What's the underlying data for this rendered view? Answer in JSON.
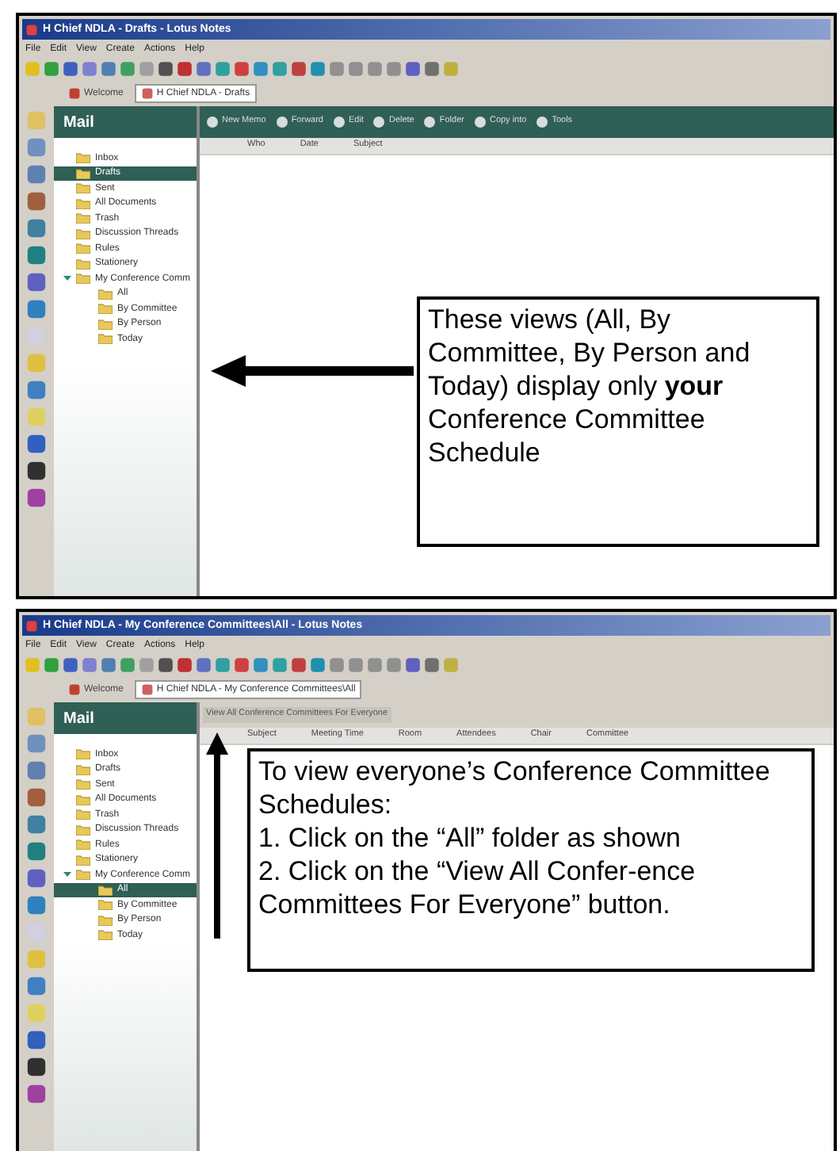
{
  "panels": [
    {
      "window_title": "H Chief NDLA - Drafts - Lotus Notes",
      "menu": [
        "File",
        "Edit",
        "View",
        "Create",
        "Actions",
        "Help"
      ],
      "tabs": [
        {
          "label": "Welcome",
          "selected": false
        },
        {
          "label": "H Chief NDLA - Drafts",
          "selected": true
        }
      ],
      "nav_title": "Mail",
      "nav_items": [
        {
          "label": "Inbox",
          "selected": false
        },
        {
          "label": "Drafts",
          "selected": true
        },
        {
          "label": "Sent",
          "selected": false
        },
        {
          "label": "All Documents",
          "selected": false
        },
        {
          "label": "Trash",
          "selected": false
        },
        {
          "label": "Discussion Threads",
          "selected": false
        },
        {
          "label": "Rules",
          "selected": false
        },
        {
          "label": "Stationery",
          "selected": false
        },
        {
          "label": "My Conference Comm",
          "selected": false,
          "expanded": true,
          "children": [
            {
              "label": "All",
              "selected": false
            },
            {
              "label": "By Committee",
              "selected": false
            },
            {
              "label": "By Person",
              "selected": false
            },
            {
              "label": "Today",
              "selected": false
            }
          ]
        }
      ],
      "action_bar": {
        "kind": "buttons",
        "buttons": [
          "New Memo",
          "Forward",
          "Edit",
          "Delete",
          "Folder",
          "Copy into",
          "Tools"
        ]
      },
      "columns": [
        "Who",
        "Date",
        "Subject"
      ],
      "callout": {
        "kind": "side",
        "paragraphs": [
          "These views (All, By Committee, By Person and Today) display only **your** Conference Committee Schedule"
        ]
      }
    },
    {
      "window_title": "H Chief NDLA - My Conference Committees\\All - Lotus Notes",
      "menu": [
        "File",
        "Edit",
        "View",
        "Create",
        "Actions",
        "Help"
      ],
      "tabs": [
        {
          "label": "Welcome",
          "selected": false
        },
        {
          "label": "H Chief NDLA - My Conference Committees\\All",
          "selected": true
        }
      ],
      "nav_title": "Mail",
      "nav_items": [
        {
          "label": "Inbox",
          "selected": false
        },
        {
          "label": "Drafts",
          "selected": false
        },
        {
          "label": "Sent",
          "selected": false
        },
        {
          "label": "All Documents",
          "selected": false
        },
        {
          "label": "Trash",
          "selected": false
        },
        {
          "label": "Discussion Threads",
          "selected": false
        },
        {
          "label": "Rules",
          "selected": false
        },
        {
          "label": "Stationery",
          "selected": false
        },
        {
          "label": "My Conference Comm",
          "selected": false,
          "expanded": true,
          "children": [
            {
              "label": "All",
              "selected": true
            },
            {
              "label": "By Committee",
              "selected": false
            },
            {
              "label": "By Person",
              "selected": false
            },
            {
              "label": "Today",
              "selected": false
            }
          ]
        }
      ],
      "action_bar": {
        "kind": "view_button",
        "label": "View All Conference Committees For Everyone"
      },
      "columns": [
        "Subject",
        "Meeting Time",
        "Room",
        "Attendees",
        "Chair",
        "Committee"
      ],
      "callout": {
        "kind": "below",
        "paragraphs": [
          "To view everyone’s Conference Committee Schedules:",
          "1.  Click on the “All” folder as shown",
          "2.  Click on the “View All Confer-ence Committees For Everyone” button."
        ]
      }
    }
  ]
}
